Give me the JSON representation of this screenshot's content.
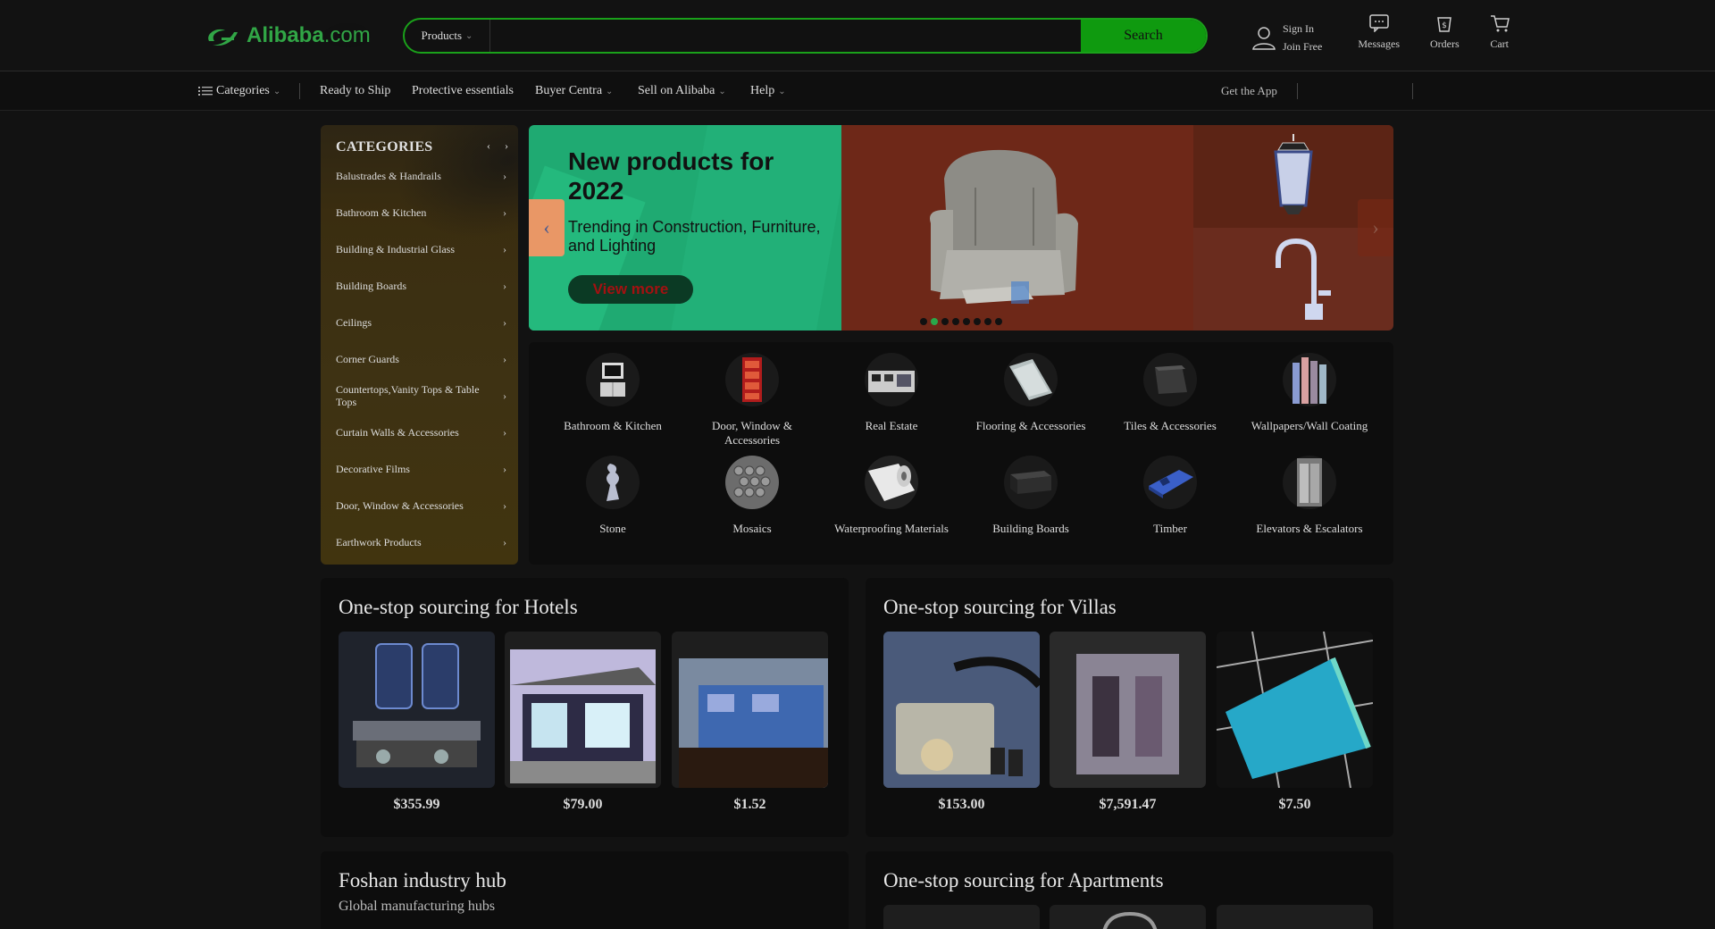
{
  "header": {
    "logo_text": "Alibaba",
    "logo_suffix": ".com",
    "search_type": "Products",
    "search_placeholder": "",
    "search_button": "Search",
    "sign_in": "Sign In",
    "join_free": "Join Free",
    "messages": "Messages",
    "orders": "Orders",
    "cart": "Cart"
  },
  "nav": {
    "categories": "Categories",
    "ready_to_ship": "Ready to Ship",
    "protective": "Protective essentials",
    "buyer_central": "Buyer Centra",
    "sell": "Sell on Alibaba",
    "help": "Help",
    "get_app": "Get the App"
  },
  "sidebar": {
    "title": "CATEGORIES",
    "items": [
      "Balustrades & Handrails",
      "Bathroom & Kitchen",
      "Building & Industrial Glass",
      "Building Boards",
      "Ceilings",
      "Corner Guards",
      "Countertops,Vanity Tops & Table Tops",
      "Curtain Walls & Accessories",
      "Decorative Films",
      "Door, Window & Accessories",
      "Earthwork Products"
    ]
  },
  "banner": {
    "title": "New products for 2022",
    "subtitle": "Trending in Construction, Furniture, and Lighting",
    "button": "View more",
    "slide_count": 8,
    "active_slide": 1
  },
  "grid": {
    "items": [
      {
        "label": "Bathroom & Kitchen",
        "icon": "cabinet-icon"
      },
      {
        "label": "Door, Window & Accessories",
        "icon": "door-icon"
      },
      {
        "label": "Real Estate",
        "icon": "building-icon"
      },
      {
        "label": "Flooring & Accessories",
        "icon": "flooring-icon"
      },
      {
        "label": "Tiles & Accessories",
        "icon": "tile-icon"
      },
      {
        "label": "Wallpapers/Wall Coating",
        "icon": "wallpaper-icon"
      },
      {
        "label": "Stone",
        "icon": "stone-icon"
      },
      {
        "label": "Mosaics",
        "icon": "mosaic-icon"
      },
      {
        "label": "Waterproofing Materials",
        "icon": "roll-icon"
      },
      {
        "label": "Building Boards",
        "icon": "board-icon"
      },
      {
        "label": "Timber",
        "icon": "timber-icon"
      },
      {
        "label": "Elevators & Escalators",
        "icon": "elevator-icon"
      }
    ]
  },
  "cards": {
    "hotels": {
      "title": "One-stop sourcing for Hotels",
      "products": [
        {
          "price": "$355.99"
        },
        {
          "price": "$79.00"
        },
        {
          "price": "$1.52"
        }
      ]
    },
    "villas": {
      "title": "One-stop sourcing for Villas",
      "products": [
        {
          "price": "$153.00"
        },
        {
          "price": "$7,591.47"
        },
        {
          "price": "$7.50"
        }
      ]
    },
    "foshan": {
      "title": "Foshan industry hub",
      "subtitle": "Global manufacturing hubs"
    },
    "apartments": {
      "title": "One-stop sourcing for Apartments"
    }
  }
}
